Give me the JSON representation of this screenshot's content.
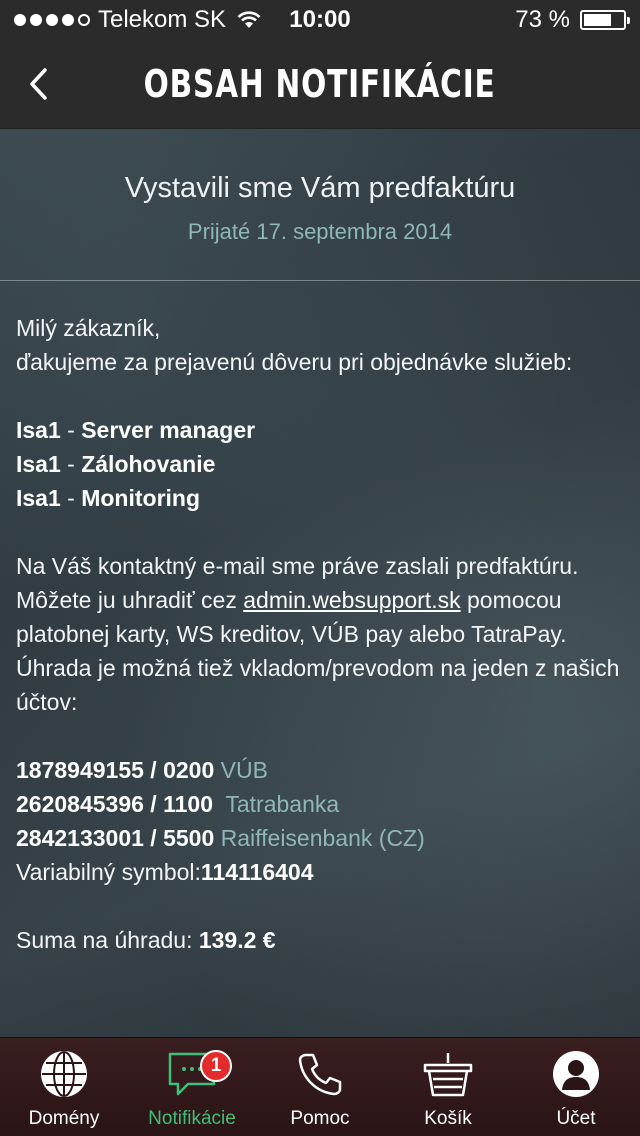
{
  "status_bar": {
    "carrier": "Telekom SK",
    "time": "10:00",
    "battery_percent": "73 %",
    "battery_level": 0.73,
    "signal_bars_filled": 4,
    "signal_bars_total": 5
  },
  "nav": {
    "title": "OBSAH NOTIFIKÁCIE",
    "back_icon": "chevron-left-icon"
  },
  "message": {
    "title": "Vystavili sme Vám predfaktúru",
    "received": "Prijaté 17. septembra 2014",
    "greeting_line1": "Milý zákazník,",
    "greeting_line2": "ďakujeme za prejavenú dôveru pri objednávke služieb:",
    "services": [
      {
        "brand": "Isa1",
        "sep": " - ",
        "name": "Server manager"
      },
      {
        "brand": "Isa1",
        "sep": " - ",
        "name": "Zálohovanie"
      },
      {
        "brand": "Isa1",
        "sep": " - ",
        "name": "Monitoring"
      }
    ],
    "info_before_link": "Na Váš kontaktný e-mail sme práve zaslali predfaktúru. Môžete ju uhradiť cez ",
    "info_link": "admin.websupport.sk",
    "info_after_link": " pomocou platobnej karty, WS kreditov, VÚB pay alebo TatraPay. Úhrada je možná tiež vkladom/prevodom na jeden z našich účtov:",
    "accounts": [
      {
        "number": "1878949155 / 0200",
        "bank": "VÚB"
      },
      {
        "number": "2620845396 / 1100",
        "bank": "Tatrabanka"
      },
      {
        "number": "2842133001 / 5500",
        "bank": "Raiffeisenbank (CZ)"
      }
    ],
    "variable_symbol_label": "Variabilný symbol:",
    "variable_symbol": "114116404",
    "total_label": "Suma na úhradu: ",
    "total_value": "139.2 €"
  },
  "tabs": [
    {
      "label": "Domény",
      "icon": "globe-icon"
    },
    {
      "label": "Notifikácie",
      "icon": "chat-bubble-icon",
      "badge": "1",
      "active": true
    },
    {
      "label": "Pomoc",
      "icon": "phone-icon"
    },
    {
      "label": "Košík",
      "icon": "basket-icon"
    },
    {
      "label": "Účet",
      "icon": "user-icon"
    }
  ],
  "colors": {
    "accent_green": "#3fbf77",
    "badge_red": "#e32b2b",
    "muted_teal": "#8fb6b8",
    "bar_dark": "#2b2b2b",
    "tabbar_dark_red": "#2a1415"
  }
}
